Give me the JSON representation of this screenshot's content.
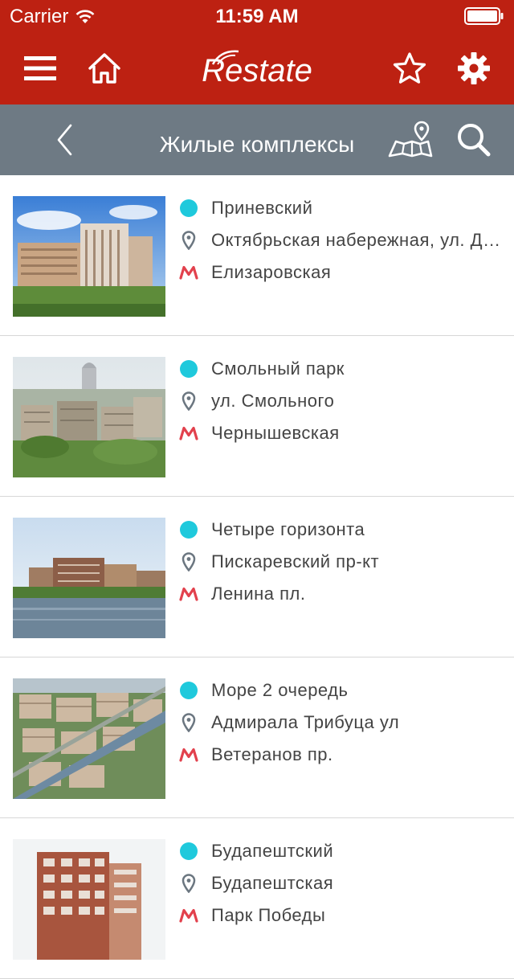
{
  "status_bar": {
    "carrier": "Carrier",
    "time": "11:59 AM"
  },
  "nav": {
    "brand": "Restate"
  },
  "sub": {
    "title": "Жилые комплексы"
  },
  "colors": {
    "nav_bg": "#bd2112",
    "sub_bg": "#6e7a84",
    "status_dot": "#1fc9dc",
    "metro": "#e2414d",
    "text": "#444444"
  },
  "icons": {
    "menu": "menu-icon",
    "home": "home-icon",
    "favorite": "star-icon",
    "settings": "gear-icon",
    "back": "chevron-left-icon",
    "map": "map-pin-icon",
    "search": "search-icon",
    "address": "location-pin-icon",
    "metro": "metro-icon"
  },
  "complexes": [
    {
      "name": "Приневский",
      "address": "Октябрьская набережная, ул. Дальневосточный",
      "metro": "Елизаровская"
    },
    {
      "name": "Смольный парк",
      "address": "ул. Смольного",
      "metro": "Чернышевская"
    },
    {
      "name": "Четыре горизонта",
      "address": "Пискаревский пр-кт",
      "metro": "Ленина пл."
    },
    {
      "name": "Море 2 очередь",
      "address": "Адмирала Трибуца ул",
      "metro": "Ветеранов пр."
    },
    {
      "name": "Будапештский",
      "address": "Будапештская",
      "metro": "Парк Победы"
    }
  ]
}
